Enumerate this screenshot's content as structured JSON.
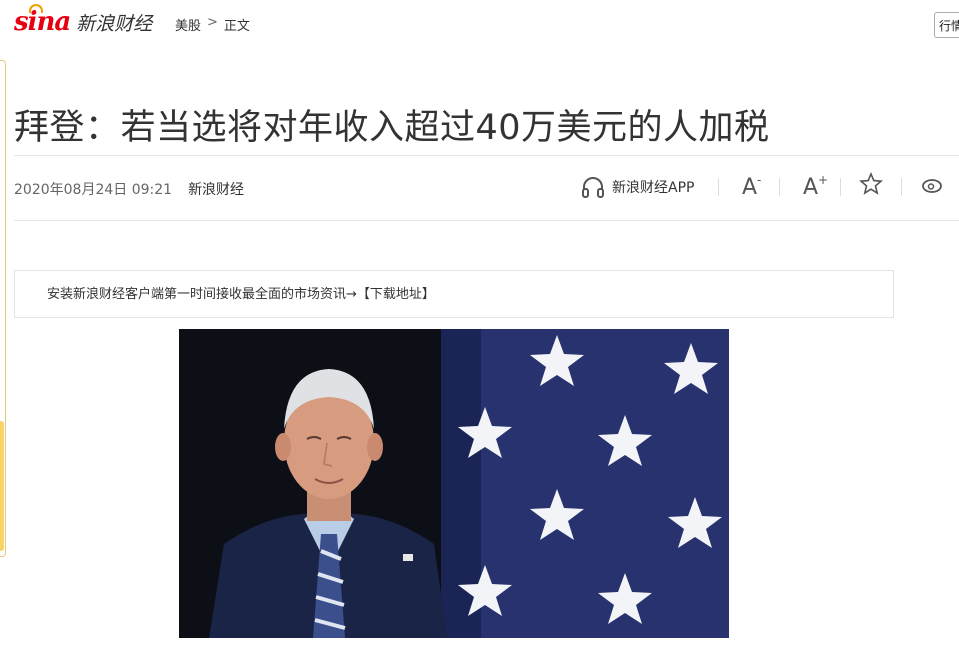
{
  "header": {
    "logo_mark": "sina",
    "logo_text": "新浪财经",
    "breadcrumb": {
      "section": "美股",
      "separator": ">",
      "current": "正文"
    },
    "side_button": "行情"
  },
  "article": {
    "title": "拜登：若当选将对年收入超过40万美元的人加税",
    "datetime": "2020年08月24日 09:21",
    "source": "新浪财经",
    "notice": "安装新浪财经客户端第一时间接收最全面的市场资讯→【下载地址】"
  },
  "toolbar": {
    "app_label": "新浪财经APP",
    "font_decrease": "A",
    "font_decrease_mark": "-",
    "font_increase": "A",
    "font_increase_mark": "+",
    "icons": [
      "headphones-icon",
      "font-decrease-icon",
      "font-increase-icon",
      "star-icon",
      "weibo-icon"
    ]
  },
  "colors": {
    "brand_red": "#e60012",
    "accent_yellow": "#f6d36b",
    "text": "#333333",
    "muted": "#666666"
  }
}
